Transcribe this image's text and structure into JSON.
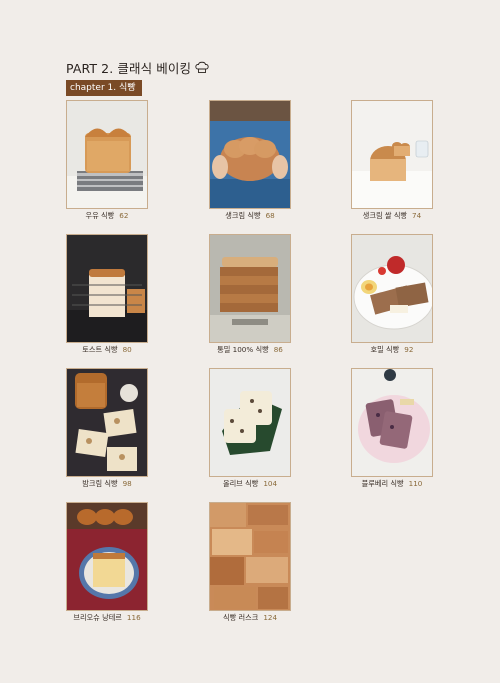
{
  "header": {
    "part_title": "PART 2. 클래식 베이킹",
    "chapter_label": "chapter 1. 식빵"
  },
  "items": [
    {
      "name": "우유 식빵",
      "page": "62"
    },
    {
      "name": "생크림 식빵",
      "page": "68"
    },
    {
      "name": "생크림 쌀 식빵",
      "page": "74"
    },
    {
      "name": "토스트 식빵",
      "page": "80"
    },
    {
      "name": "통밀 100% 식빵",
      "page": "86"
    },
    {
      "name": "호밀 식빵",
      "page": "92"
    },
    {
      "name": "밤크림 식빵",
      "page": "98"
    },
    {
      "name": "올리브 식빵",
      "page": "104"
    },
    {
      "name": "블루베리 식빵",
      "page": "110"
    },
    {
      "name": "브리오슈 낭테르",
      "page": "116"
    },
    {
      "name": "식빵 러스크",
      "page": "124"
    }
  ],
  "colors": {
    "page_bg": "#f1ede9",
    "chapter_bg": "#7a4a26",
    "photo_border": "#c8ad8e"
  }
}
